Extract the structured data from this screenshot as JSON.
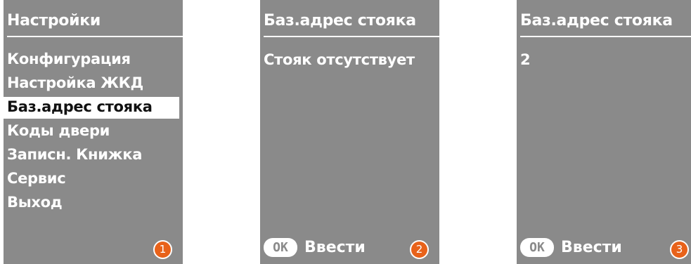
{
  "screens": [
    {
      "title": "Настройки",
      "menu_items": [
        {
          "label": "Конфигурация",
          "selected": false
        },
        {
          "label": "Настройка ЖКД",
          "selected": false
        },
        {
          "label": "Баз.адрес стояка",
          "selected": true
        },
        {
          "label": "Коды двери",
          "selected": false
        },
        {
          "label": "Записн. Книжка",
          "selected": false
        },
        {
          "label": "Сервис",
          "selected": false
        },
        {
          "label": "Выход",
          "selected": false
        }
      ],
      "step": "1"
    },
    {
      "title": "Баз.адрес стояка",
      "body": "Стояк отсутствует",
      "ok_key": "OK",
      "ok_label": "Ввести",
      "step": "2"
    },
    {
      "title": "Баз.адрес стояка",
      "body": "2",
      "ok_key": "OK",
      "ok_label": "Ввести",
      "step": "3"
    }
  ],
  "colors": {
    "screen_background": "#8a8a8a",
    "text": "#ffffff",
    "selection_background": "#ffffff",
    "selection_text": "#111111",
    "step_badge": "#e8621a"
  }
}
